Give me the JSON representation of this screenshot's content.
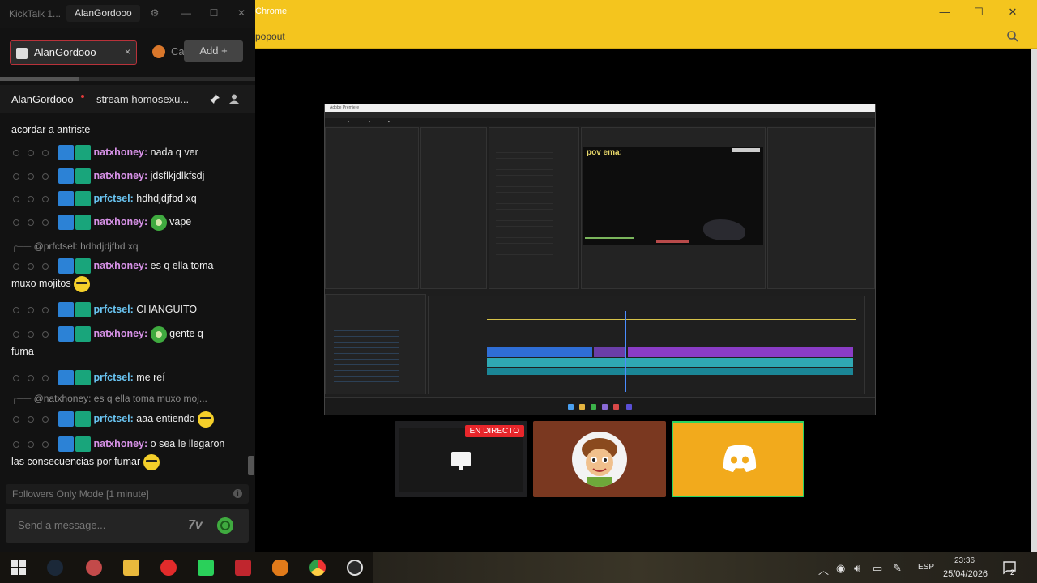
{
  "kicktalk": {
    "app_title": "KickTalk 1...",
    "user_title": "AlanGordooo",
    "tabs": [
      {
        "label": "AlanGordooo",
        "close": "×"
      },
      {
        "label": "Ca"
      }
    ],
    "add_button": "Add +",
    "chat_header": {
      "channel": "AlanGordooo",
      "stream_title": "stream homosexu..."
    },
    "messages": [
      {
        "text": "acordar a antriste"
      },
      {
        "user": "natxhoney:",
        "text": "nada q ver"
      },
      {
        "user": "natxhoney:",
        "text": "jdsflkjdlkfsdj"
      },
      {
        "user": "prfctsel:",
        "text": "hdhdjdjfbd xq"
      },
      {
        "user": "natxhoney:",
        "text": "vape",
        "emote": "green-emote"
      },
      {
        "reply": "@prfctsel: hdhdjdjfbd xq"
      },
      {
        "user": "natxhoney:",
        "text": "es q ella toma",
        "text2": "muxo mojitos",
        "emote": "yellow-emote"
      },
      {
        "user": "prfctsel:",
        "text": "CHANGUITO"
      },
      {
        "user": "natxhoney:",
        "text": "gente q",
        "text2": "fuma",
        "emote": "green-emote"
      },
      {
        "user": "prfctsel:",
        "text": "me reí"
      },
      {
        "reply": "@natxhoney: es q ella toma muxo moj..."
      },
      {
        "user": "prfctsel:",
        "text": "aaa entiendo",
        "emote": "yellow-emote"
      },
      {
        "user": "natxhoney:",
        "text": "o sea le llegaron",
        "text2": "las consecuencias por fumar",
        "emote": "yellow-emote"
      }
    ],
    "followers_mode": "Followers Only Mode [1 minute]",
    "input_placeholder": "Send a message..."
  },
  "chrome": {
    "title": "Chrome",
    "popout_label": "popout",
    "screen_share": {
      "app_title": "Adobe Premiere",
      "program_caption": "pov ema:"
    },
    "tiles": {
      "live_badge": "EN DIRECTO"
    }
  },
  "taskbar": {
    "language": "ESP",
    "time": "23:36",
    "date": "25/04/2026",
    "notifications": "2"
  },
  "colors": {
    "chrome_accent": "#f4c51e",
    "kick_user_natx": "#d892e8",
    "kick_user_prf": "#69c3f0",
    "live_red": "#e8262b",
    "discord_tile": "#f2aa1c"
  }
}
